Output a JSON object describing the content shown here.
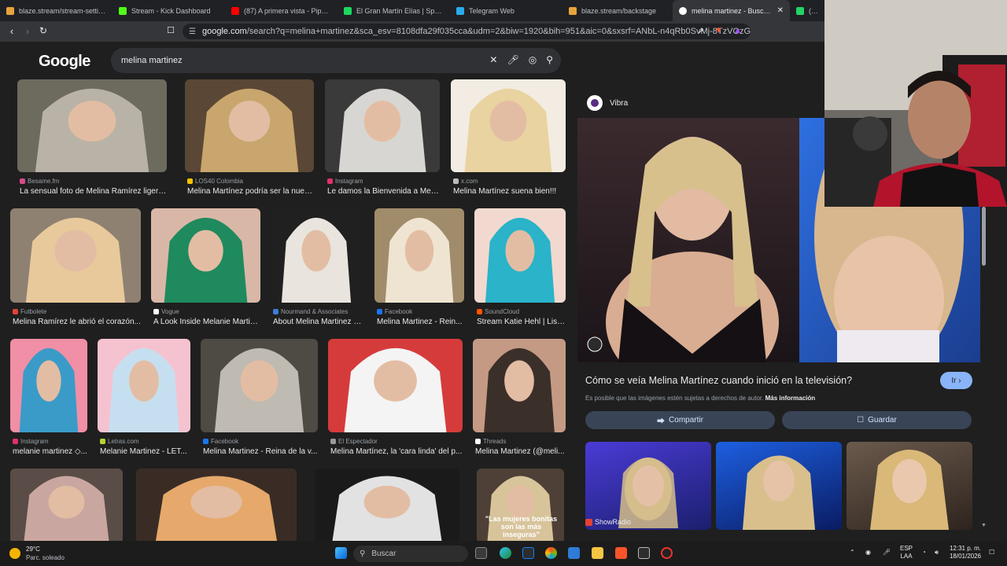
{
  "tabs": [
    {
      "label": "blaze.stream/stream-settings",
      "color": "#e8a33d"
    },
    {
      "label": "Stream - Kick Dashboard",
      "color": "#53fc18"
    },
    {
      "label": "(87) A primera vista - Pipe Bueno",
      "color": "#ff0000"
    },
    {
      "label": "El Gran Martín Elías | Spotify",
      "color": "#1ed760"
    },
    {
      "label": "Telegram Web",
      "color": "#2aabee"
    },
    {
      "label": "blaze.stream/backstage",
      "color": "#e8a33d"
    },
    {
      "label": "melina martinez - Buscar con Google",
      "color": "#ffffff",
      "active": true
    },
    {
      "label": "(81) Wh",
      "color": "#25d366"
    }
  ],
  "address": {
    "url_domain": "google.com",
    "url_rest": "/search?q=melina+martinez&sca_esv=8108dfa29f035cca&udm=2&biw=1920&bih=951&aic=0&sxsrf=ANbL-n4qRb0SvMj-8TzVOzGa41y..."
  },
  "google": {
    "logo": "Google",
    "query": "melina martinez"
  },
  "results": [
    {
      "source": "Besame.fm",
      "caption": "La sensual foto de Melina Ramírez ligerita d...",
      "c1": "#b9b2a6",
      "c2": "#6d6a5e",
      "sc": "#d94a8a"
    },
    {
      "source": "LOS40 Colombia",
      "caption": "Melina Martínez podría ser la nuev...",
      "c1": "#c9a66d",
      "c2": "#5b4735",
      "sc": "#f7c400"
    },
    {
      "source": "Instagram",
      "caption": "Le damos la Bienvenida a Meli...",
      "c1": "#d8d6d2",
      "c2": "#3a3a3a",
      "sc": "#e1306c"
    },
    {
      "source": "x.com",
      "caption": "Melina Martínez suena bien!!!",
      "c1": "#e9d3a0",
      "c2": "#f2ece2",
      "sc": "#bbbbbb"
    },
    {
      "source": "Futbolete",
      "caption": "Melina Ramírez le abrió el corazón...",
      "c1": "#e8c99b",
      "c2": "#8f8172",
      "sc": "#e34234"
    },
    {
      "source": "Vogue",
      "caption": "A Look Inside Melanie Martin...",
      "c1": "#1f8a5e",
      "c2": "#d9b7a6",
      "sc": "#ffffff"
    },
    {
      "source": "Nourmand & Associates",
      "caption": "About Melina Martinez |...",
      "c1": "#e9e4de",
      "c2": "#202020",
      "sc": "#3b7dd8"
    },
    {
      "source": "Facebook",
      "caption": "Melina Martinez - Rein...",
      "c1": "#efe4d2",
      "c2": "#a08c6a",
      "sc": "#1877f2"
    },
    {
      "source": "SoundCloud",
      "caption": "Stream Katie Hehl | List...",
      "c1": "#2ab3c9",
      "c2": "#f1d9cf",
      "sc": "#ff5500"
    },
    {
      "source": "Instagram",
      "caption": "melanie martinez ◇...",
      "c1": "#3a9bc8",
      "c2": "#f08fa6",
      "sc": "#e1306c"
    },
    {
      "source": "Letras.com",
      "caption": "Melanie Martinez - LET...",
      "c1": "#c6dff0",
      "c2": "#f5c2d0",
      "sc": "#b5d335"
    },
    {
      "source": "Facebook",
      "caption": "Melina Martinez - Reina de la v...",
      "c1": "#bfbab2",
      "c2": "#4e4a44",
      "sc": "#1877f2"
    },
    {
      "source": "El Espectador",
      "caption": "Melina Martínez, la 'cara linda' del p...",
      "c1": "#f4f4f4",
      "c2": "#d63b3b",
      "sc": "#999999"
    },
    {
      "source": "Threads",
      "caption": "Melina Martinez (@meli...",
      "c1": "#3b2f2a",
      "c2": "#c49a84",
      "sc": "#ffffff"
    },
    {
      "source": "",
      "caption": "",
      "c1": "#c9a7a0",
      "c2": "#5a4c46",
      "sc": "#000000"
    },
    {
      "source": "",
      "caption": "",
      "c1": "#e6a96b",
      "c2": "#3a2c25",
      "sc": "#000000"
    },
    {
      "source": "",
      "caption": "",
      "c1": "#e2e2e2",
      "c2": "#1a1a1a",
      "sc": "#000000"
    },
    {
      "source": "",
      "caption": "",
      "c1": "#d8c49b",
      "c2": "#4e4036",
      "sc": "#000000",
      "overlay": "\"Las mujeres bonitas son las más inseguras\""
    }
  ],
  "panel": {
    "source": "Vibra",
    "title": "Cómo se veía Melina Martínez cuando inició en la televisión?",
    "go_label": "Ir",
    "copyright": "Es posible que las imágenes estén sujetas a derechos de autor.",
    "more_info": "Más información",
    "share_label": "Compartir",
    "save_label": "Guardar",
    "related_source": "ShowRadio"
  },
  "taskbar": {
    "temp": "29°C",
    "weather": "Parc. soleado",
    "search_placeholder": "Buscar",
    "lang1": "ESP",
    "lang2": "LAA",
    "time": "12:31 p. m.",
    "date": "18/01/2026"
  }
}
